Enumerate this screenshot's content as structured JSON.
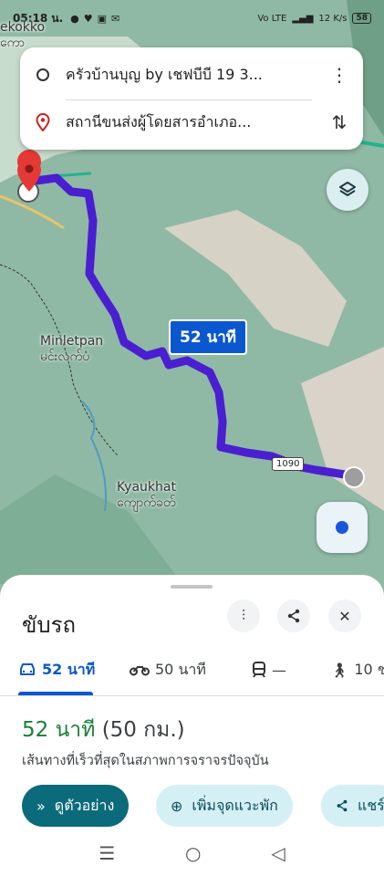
{
  "status": {
    "time": "05:18 น.",
    "icons": [
      "●",
      "♥",
      "▣",
      "✉"
    ],
    "net_label": "Vo LTE",
    "speed": "12 K/s",
    "battery": "58"
  },
  "search": {
    "origin_text": "ครัวบ้านบุญ by เชฟบีบี 19 3...",
    "destination_text": "สถานีขนส่งผู้โดยสารอำเภอ..."
  },
  "map": {
    "eta_bubble": "52 นาที",
    "road_number": "1090",
    "places": [
      {
        "name_en": "Minletpan",
        "name_my": "မင်းလက်ပံ"
      },
      {
        "name_en": "Kyaukhat",
        "name_my": "ကျောက်ခတ်"
      },
      {
        "name_en": "ekokko",
        "name_my": "ကော"
      }
    ],
    "colors": {
      "route": "#4a1ed1",
      "pin": "#e53935",
      "terrain": "#8fb9a4"
    }
  },
  "sheet": {
    "title": "ขับรถ",
    "modes": [
      {
        "icon": "car-icon",
        "label": "52 นาที",
        "active": true
      },
      {
        "icon": "motorcycle-icon",
        "label": "50 นาที",
        "active": false
      },
      {
        "icon": "transit-icon",
        "label": "—",
        "active": false
      },
      {
        "icon": "walk-icon",
        "label": "10 ช",
        "active": false
      }
    ],
    "summary_time": "52 นาที",
    "summary_distance": "(50 กม.)",
    "route_description": "เส้นทางที่เร็วที่สุดในสภาพการจราจรปัจจุบัน",
    "chips": {
      "preview": "ดูตัวอย่าง",
      "add_stop": "เพิ่มจุดแวะพัก",
      "share": "แชร์"
    }
  }
}
